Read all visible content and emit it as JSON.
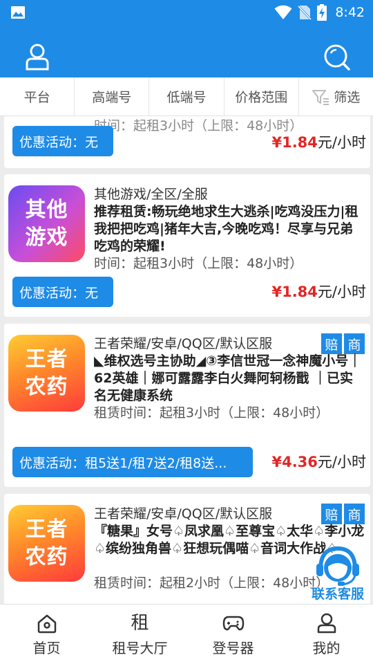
{
  "status_bar": {
    "time": "8:42"
  },
  "colors": {
    "primary": "#1e8be6",
    "price": "#e42525"
  },
  "header": {
    "left_icon": "user-icon",
    "right_icon": "search-icon"
  },
  "filters": [
    {
      "label": "平台"
    },
    {
      "label": "高端号"
    },
    {
      "label": "低端号"
    },
    {
      "label": "价格范围"
    },
    {
      "label": "筛选",
      "icon": "filter-icon"
    }
  ],
  "cards": [
    {
      "time": "时间：起租3小时（上限：48小时）",
      "promo": "优惠活动：无",
      "price": "¥1.84",
      "price_unit": "元/小时"
    },
    {
      "cover": "其他游戏",
      "category": "其他游戏/全区/全服",
      "title": "推荐租赁:畅玩绝地求生大逃杀|吃鸡没压力|租我把把吃鸡|猪年大吉,今晚吃鸡！尽享与兄弟吃鸡的荣耀!",
      "time": "时间：起租3小时（上限：48小时）",
      "promo": "优惠活动：无",
      "price": "¥1.84",
      "price_unit": "元/小时"
    },
    {
      "cover": "王者农药",
      "category": "王者荣耀/安卓/QQ区/默认区服",
      "tags": [
        "赔",
        "商"
      ],
      "title": "◣维权选号主协助◢③李信世冠一念神魔小号｜62英雄｜娜可露露李白火舞阿轲杨戬 ｜已实名无健康系统",
      "time": "租赁时间：起租3小时（上限：48小时）",
      "promo": "优惠活动：租5送1/租7送2/租8送...",
      "price": "¥4.36",
      "price_unit": "元/小时"
    },
    {
      "cover": "王者农药",
      "category": "王者荣耀/安卓/QQ区/默认区服",
      "tags": [
        "赔",
        "商"
      ],
      "title": "『糖果』女号♤凤求凰♤至尊宝♤太华♤李小龙♤缤纷独角兽♤狂想玩偶喵♤音词大作战♤",
      "time": "租赁时间：起租2小时（上限：48小时）"
    }
  ],
  "float_button": {
    "label": "联系客服",
    "icon": "customer-service-icon"
  },
  "bottom_nav": [
    {
      "label": "首页",
      "icon": "home-icon"
    },
    {
      "label": "租号大厅",
      "glyph": "租"
    },
    {
      "label": "登号器",
      "icon": "gamepad-icon"
    },
    {
      "label": "我的",
      "icon": "profile-icon"
    }
  ]
}
